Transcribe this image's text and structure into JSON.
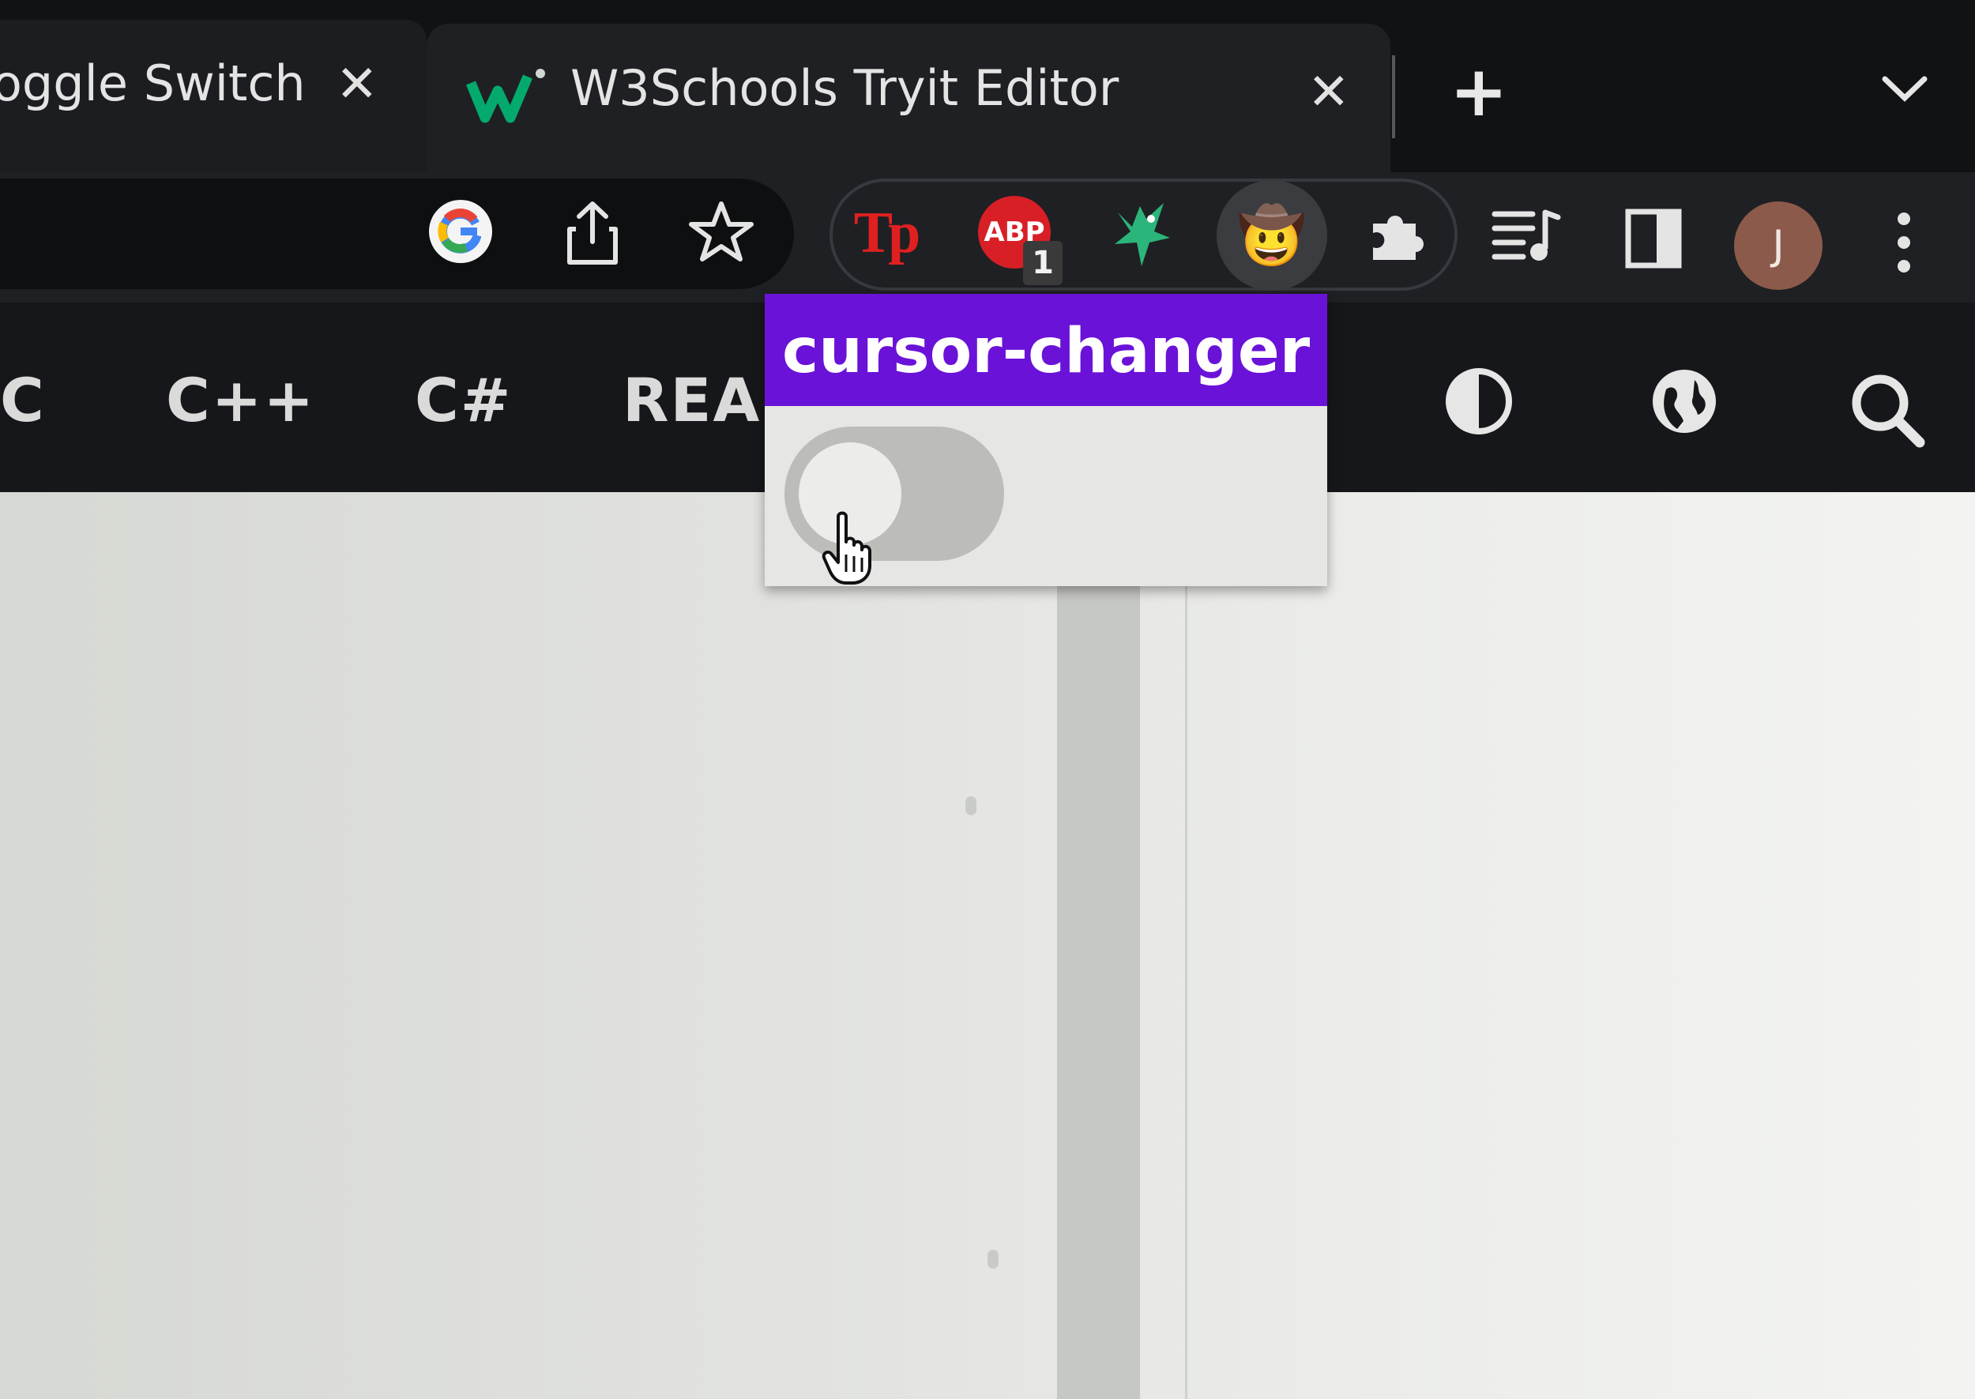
{
  "tabs": [
    {
      "title": "oggle Switch",
      "active": false
    },
    {
      "title": "W3Schools Tryit Editor",
      "active": true
    }
  ],
  "tab_close_glyph": "✕",
  "new_tab_glyph": "+",
  "toolbar": {
    "icons": [
      "google-lens-icon",
      "share-icon",
      "bookmark-star-icon",
      "tp-extension-icon",
      "adblock-icon",
      "green-extension-icon",
      "cowboy-emoji-icon",
      "extensions-puzzle-icon",
      "media-queue-icon",
      "side-panel-icon",
      "profile-avatar",
      "more-menu-icon"
    ],
    "tp_label": "Tp",
    "abp_label": "ABP",
    "abp_badge": "1",
    "cowboy_emoji": "🤠",
    "avatar_initial": "J",
    "more_glyph": "⋮"
  },
  "nav": {
    "items": [
      "C",
      "C++",
      "C#",
      "REA"
    ]
  },
  "popup": {
    "title": "cursor-changer",
    "toggle_on": false,
    "header_color": "#6a12d8"
  },
  "colors": {
    "tabstrip": "#111214",
    "active_tab": "#1f2023",
    "w3_green": "#04aa6d"
  }
}
